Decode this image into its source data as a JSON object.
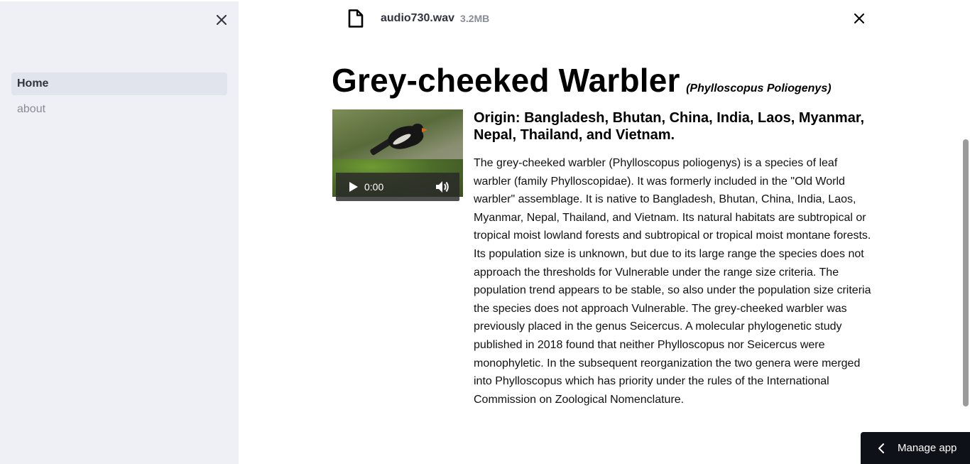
{
  "sidebar": {
    "close_icon": "close-icon",
    "items": [
      {
        "label": "Home",
        "active": true
      },
      {
        "label": "about",
        "active": false
      }
    ]
  },
  "file": {
    "icon": "file-icon",
    "name": "audio730.wav",
    "size": "3.2MB"
  },
  "species": {
    "common_name": "Grey-cheeked Warbler",
    "scientific_name": "(Phylloscopus Poliogenys)",
    "origin": "Origin: Bangladesh, Bhutan, China, India, Laos, Myanmar, Nepal, Thailand, and Vietnam.",
    "description": "The grey-cheeked warbler (Phylloscopus poliogenys) is a species of leaf warbler (family Phylloscopidae). It was formerly included in the \"Old World warbler\" assemblage. It is native to Bangladesh, Bhutan, China, India, Laos, Myanmar, Nepal, Thailand, and Vietnam. Its natural habitats are subtropical or tropical moist lowland forests and subtropical or tropical moist montane forests. Its population size is unknown, but due to its large range the species does not approach the thresholds for Vulnerable under the range size criteria. The population trend appears to be stable, so also under the population size criteria the species does not approach Vulnerable. The grey-cheeked warbler was previously placed in the genus Seicercus. A molecular phylogenetic study published in 2018 found that neither Phylloscopus nor Seicercus were monophyletic. In the subsequent reorganization the two genera were merged into Phylloscopus which has priority under the rules of the International Commission on Zoological Nomenclature."
  },
  "audio_player": {
    "time": "0:00",
    "play_icon": "play-icon",
    "volume_icon": "volume-icon"
  },
  "manage_app": {
    "label": "Manage app",
    "icon": "chevron-left-icon"
  },
  "colors": {
    "sidebar_bg": "#eef0f5",
    "active_item_bg": "#e1e4ec",
    "manage_bg": "#0e1117"
  }
}
